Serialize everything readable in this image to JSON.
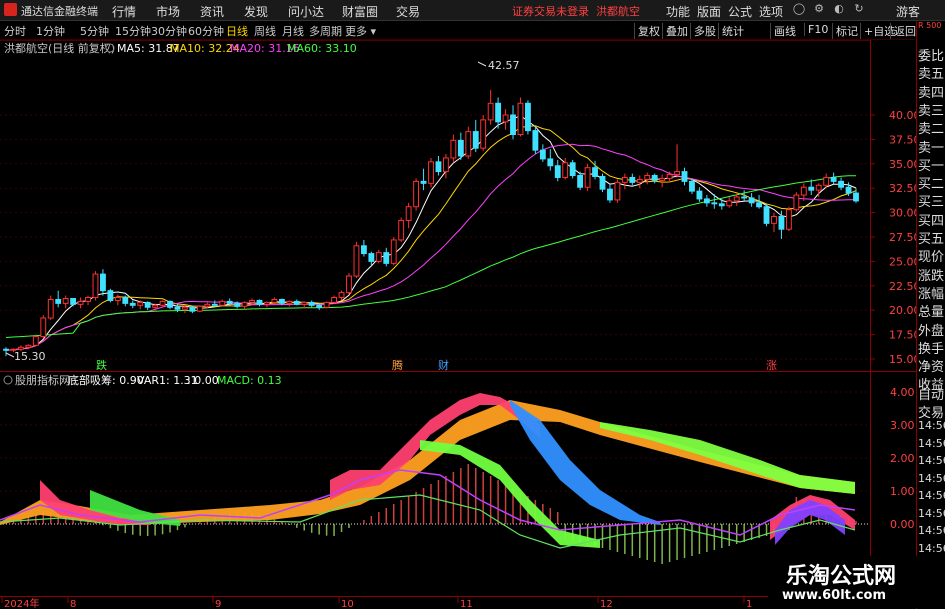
{
  "menubar": {
    "app_name": "通达信金融终端",
    "items": [
      "行情",
      "市场",
      "资讯",
      "发现",
      "问小达",
      "财富圈",
      "交易"
    ],
    "status": "证券交易未登录",
    "stock_name": "洪都航空",
    "right_items": [
      "功能",
      "版面",
      "公式",
      "选项"
    ],
    "user": "游客"
  },
  "toolbar": {
    "periods": [
      "分时",
      "1分钟",
      "5分钟",
      "15分钟",
      "30分钟",
      "60分钟",
      "日线",
      "周线",
      "月线",
      "多周期",
      "更多"
    ],
    "active": "日线",
    "right_buttons": [
      "复权",
      "叠加",
      "多股",
      "统计",
      "画线",
      "F10",
      "标记",
      "+自选",
      "返回"
    ]
  },
  "main_chart": {
    "title": "洪都航空(日线 前复权)",
    "ma": [
      {
        "label": "MA5: 31.87",
        "color": "#ffffff"
      },
      {
        "label": "MA10: 32.24",
        "color": "#ffd700"
      },
      {
        "label": "MA20: 31.16",
        "color": "#ff40ff"
      },
      {
        "label": "MA60: 33.10",
        "color": "#40ff40"
      }
    ],
    "y_ticks": [
      "40.00",
      "37.50",
      "35.00",
      "32.50",
      "30.00",
      "27.50",
      "25.00",
      "22.50",
      "20.00",
      "17.50",
      "15.00"
    ],
    "high_label": "42.57",
    "low_label": "15.30",
    "markers": [
      {
        "text": "跌",
        "color": "#40ff40"
      },
      {
        "text": "腾",
        "color": "#ffa040"
      },
      {
        "text": "财",
        "color": "#40a0ff"
      },
      {
        "text": "涨",
        "color": "#ff4040"
      }
    ]
  },
  "sub_chart": {
    "title": "股朋指标网",
    "line_bottom": "底部吸筹: 0.90",
    "line_var": "VAR1: 1.31",
    "line_zero": ": 0.00",
    "line_macd": "MACD: 0.13",
    "y_ticks": [
      "4.00",
      "3.00",
      "2.00",
      "1.00",
      "0.00"
    ]
  },
  "x_axis": {
    "labels": [
      "2024年",
      "8",
      "9",
      "10",
      "11",
      "12",
      "1"
    ]
  },
  "right_panel": {
    "top_label": "R 500",
    "items": [
      "委比",
      "卖五",
      "卖四",
      "卖三",
      "卖二",
      "卖一",
      "买一",
      "买二",
      "买三",
      "买四",
      "买五",
      "现价",
      "涨跌",
      "涨幅",
      "总量",
      "外盘",
      "换手",
      "净资",
      "收益"
    ],
    "lower_items": [
      "自动",
      "交易",
      "14:56",
      "14:56",
      "14:56",
      "14:56",
      "14:56",
      "14:56",
      "14:56",
      "14:56"
    ]
  },
  "watermark": {
    "title": "乐淘公式网",
    "url": "www.60lt.com"
  },
  "colors": {
    "up": "#ff3030",
    "down": "#40e0ff",
    "bg": "#000000",
    "grid": "#500000",
    "axis_text": "#ff4040"
  },
  "chart_data": {
    "type": "candlestick",
    "ylim": [
      14.5,
      43.5
    ],
    "candles": [
      [
        16.0,
        16.2,
        15.3,
        15.9
      ],
      [
        15.9,
        16.1,
        15.7,
        16.0
      ],
      [
        16.0,
        16.4,
        15.8,
        16.2
      ],
      [
        16.2,
        16.5,
        16.0,
        16.4
      ],
      [
        16.4,
        17.5,
        16.3,
        17.3
      ],
      [
        17.3,
        19.5,
        17.1,
        19.2
      ],
      [
        19.2,
        21.5,
        19.0,
        21.1
      ],
      [
        21.1,
        22.0,
        20.3,
        20.7
      ],
      [
        20.7,
        21.5,
        20.2,
        21.2
      ],
      [
        21.2,
        21.0,
        20.4,
        20.6
      ],
      [
        20.6,
        21.3,
        20.2,
        20.9
      ],
      [
        20.9,
        21.5,
        20.5,
        21.3
      ],
      [
        21.3,
        24.0,
        21.0,
        23.7
      ],
      [
        23.7,
        24.2,
        21.5,
        22.0
      ],
      [
        22.0,
        22.2,
        20.8,
        21.0
      ],
      [
        21.0,
        21.6,
        20.5,
        21.3
      ],
      [
        21.3,
        21.5,
        20.4,
        20.7
      ],
      [
        20.7,
        21.0,
        20.2,
        20.5
      ],
      [
        20.5,
        21.0,
        20.1,
        20.8
      ],
      [
        20.8,
        20.9,
        20.0,
        20.3
      ],
      [
        20.3,
        20.7,
        19.9,
        20.5
      ],
      [
        20.5,
        21.0,
        20.3,
        20.9
      ],
      [
        20.9,
        21.0,
        20.1,
        20.3
      ],
      [
        20.3,
        20.6,
        19.8,
        20.1
      ],
      [
        20.1,
        20.5,
        19.7,
        20.3
      ],
      [
        20.3,
        20.4,
        19.7,
        19.9
      ],
      [
        19.9,
        20.5,
        19.8,
        20.4
      ],
      [
        20.4,
        20.8,
        20.2,
        20.6
      ],
      [
        20.6,
        21.0,
        20.3,
        20.5
      ],
      [
        20.5,
        21.1,
        20.4,
        20.9
      ],
      [
        20.9,
        21.2,
        20.5,
        20.7
      ],
      [
        20.7,
        20.9,
        20.2,
        20.4
      ],
      [
        20.4,
        20.9,
        20.1,
        20.8
      ],
      [
        20.8,
        21.2,
        20.5,
        21.0
      ],
      [
        21.0,
        21.1,
        20.4,
        20.6
      ],
      [
        20.6,
        20.9,
        20.3,
        20.8
      ],
      [
        20.8,
        21.3,
        20.6,
        21.1
      ],
      [
        21.1,
        21.2,
        20.5,
        20.7
      ],
      [
        20.7,
        21.0,
        20.4,
        20.9
      ],
      [
        20.9,
        21.1,
        20.5,
        20.6
      ],
      [
        20.6,
        20.9,
        20.2,
        20.8
      ],
      [
        20.8,
        21.0,
        20.3,
        20.5
      ],
      [
        20.5,
        20.7,
        20.0,
        20.3
      ],
      [
        20.3,
        20.9,
        20.2,
        20.8
      ],
      [
        20.8,
        21.5,
        20.7,
        21.3
      ],
      [
        21.3,
        22.0,
        21.0,
        21.8
      ],
      [
        21.8,
        23.8,
        21.6,
        23.5
      ],
      [
        23.5,
        27.0,
        23.3,
        26.6
      ],
      [
        26.6,
        27.2,
        25.5,
        25.8
      ],
      [
        25.8,
        26.0,
        24.6,
        25.0
      ],
      [
        25.0,
        26.2,
        24.8,
        25.9
      ],
      [
        25.9,
        26.4,
        24.5,
        24.8
      ],
      [
        24.8,
        27.5,
        24.6,
        27.2
      ],
      [
        27.2,
        29.5,
        27.0,
        29.2
      ],
      [
        29.2,
        31.0,
        28.4,
        30.6
      ],
      [
        30.6,
        33.5,
        30.2,
        33.2
      ],
      [
        33.2,
        34.5,
        32.3,
        33.0
      ],
      [
        33.0,
        35.6,
        32.6,
        35.2
      ],
      [
        35.2,
        35.8,
        33.8,
        34.2
      ],
      [
        34.2,
        36.0,
        33.5,
        35.6
      ],
      [
        35.6,
        38.0,
        35.2,
        37.4
      ],
      [
        37.4,
        38.2,
        35.4,
        35.8
      ],
      [
        35.8,
        38.8,
        35.5,
        38.3
      ],
      [
        38.3,
        39.5,
        36.2,
        36.6
      ],
      [
        36.6,
        40.0,
        36.3,
        39.5
      ],
      [
        39.5,
        42.57,
        39.0,
        41.2
      ],
      [
        41.2,
        41.8,
        38.6,
        39.3
      ],
      [
        39.3,
        40.6,
        38.5,
        40.0
      ],
      [
        40.0,
        41.0,
        37.5,
        38.0
      ],
      [
        38.0,
        41.8,
        37.8,
        41.2
      ],
      [
        41.2,
        41.5,
        38.0,
        38.4
      ],
      [
        38.4,
        38.9,
        36.0,
        36.4
      ],
      [
        36.4,
        37.0,
        35.2,
        35.5
      ],
      [
        35.5,
        36.5,
        34.3,
        34.8
      ],
      [
        34.8,
        35.4,
        33.2,
        33.6
      ],
      [
        33.6,
        35.6,
        33.4,
        35.1
      ],
      [
        35.1,
        35.4,
        33.5,
        33.8
      ],
      [
        33.8,
        34.2,
        32.3,
        32.6
      ],
      [
        32.6,
        35.0,
        32.2,
        34.6
      ],
      [
        34.6,
        35.3,
        33.4,
        33.7
      ],
      [
        33.7,
        34.0,
        32.1,
        32.4
      ],
      [
        32.4,
        32.9,
        31.0,
        31.3
      ],
      [
        31.3,
        33.4,
        31.0,
        33.1
      ],
      [
        33.1,
        34.0,
        32.4,
        33.6
      ],
      [
        33.6,
        34.0,
        32.8,
        33.1
      ],
      [
        33.1,
        33.8,
        32.5,
        33.4
      ],
      [
        33.4,
        34.1,
        32.9,
        33.8
      ],
      [
        33.8,
        34.0,
        33.0,
        33.3
      ],
      [
        33.3,
        33.9,
        32.6,
        33.5
      ],
      [
        33.5,
        34.2,
        33.1,
        33.9
      ],
      [
        33.9,
        37.0,
        33.6,
        34.2
      ],
      [
        34.2,
        34.6,
        32.8,
        33.2
      ],
      [
        33.2,
        33.5,
        31.9,
        32.2
      ],
      [
        32.2,
        32.6,
        31.1,
        31.4
      ],
      [
        31.4,
        31.8,
        30.6,
        31.0
      ],
      [
        31.0,
        31.9,
        30.4,
        30.9
      ],
      [
        30.9,
        31.4,
        30.3,
        30.7
      ],
      [
        30.7,
        31.6,
        30.5,
        31.2
      ],
      [
        31.2,
        32.0,
        30.7,
        31.6
      ],
      [
        31.6,
        32.3,
        31.2,
        31.5
      ],
      [
        31.5,
        32.0,
        30.6,
        31.0
      ],
      [
        31.0,
        31.8,
        30.4,
        30.6
      ],
      [
        30.6,
        30.9,
        28.6,
        28.9
      ],
      [
        28.9,
        30.0,
        28.0,
        29.6
      ],
      [
        29.6,
        30.2,
        27.3,
        28.3
      ],
      [
        28.3,
        30.6,
        28.1,
        30.3
      ],
      [
        30.3,
        32.1,
        30.1,
        31.8
      ],
      [
        31.8,
        33.0,
        31.2,
        32.6
      ],
      [
        32.6,
        33.4,
        31.8,
        32.3
      ],
      [
        32.3,
        33.0,
        31.6,
        32.8
      ],
      [
        32.8,
        34.0,
        32.5,
        33.6
      ],
      [
        33.6,
        34.1,
        32.9,
        33.2
      ],
      [
        33.2,
        33.6,
        32.3,
        32.6
      ],
      [
        32.6,
        33.1,
        31.7,
        32.0
      ],
      [
        32.0,
        32.5,
        31.0,
        31.2
      ]
    ]
  }
}
